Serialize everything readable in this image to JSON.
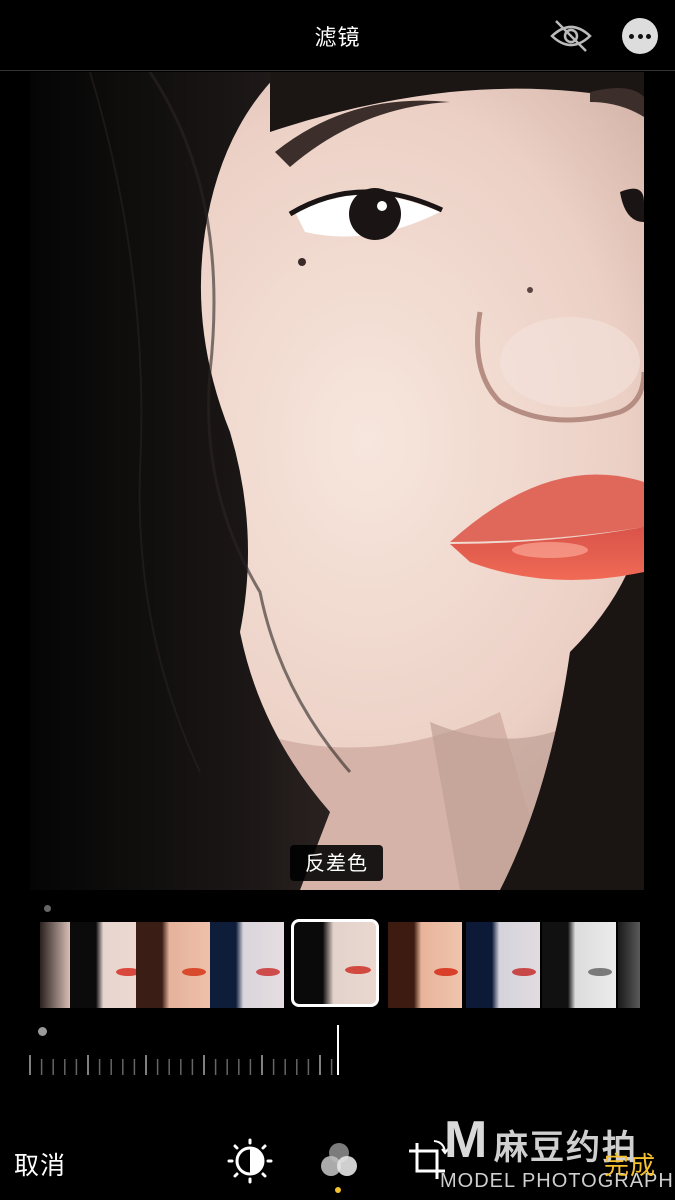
{
  "header": {
    "title": "滤镜",
    "hide_icon": "eye-slash-icon",
    "more_icon": "ellipsis-icon"
  },
  "photo": {
    "filter_name": "反差色"
  },
  "filters": {
    "selected_index": 4,
    "thumbnails": [
      "original",
      "vivid",
      "warm",
      "cool",
      "dramatic",
      "warm-dramatic",
      "cool-dramatic",
      "mono",
      "noir"
    ]
  },
  "toolbar": {
    "cancel_label": "取消",
    "done_label": "完成",
    "tools": [
      "adjust-icon",
      "filters-icon",
      "crop-icon"
    ],
    "accent_color": "#f5c12d"
  },
  "watermark": {
    "logo": "M",
    "cn": "麻豆约拍",
    "en": "MODEL PHOTOGRAPH"
  }
}
